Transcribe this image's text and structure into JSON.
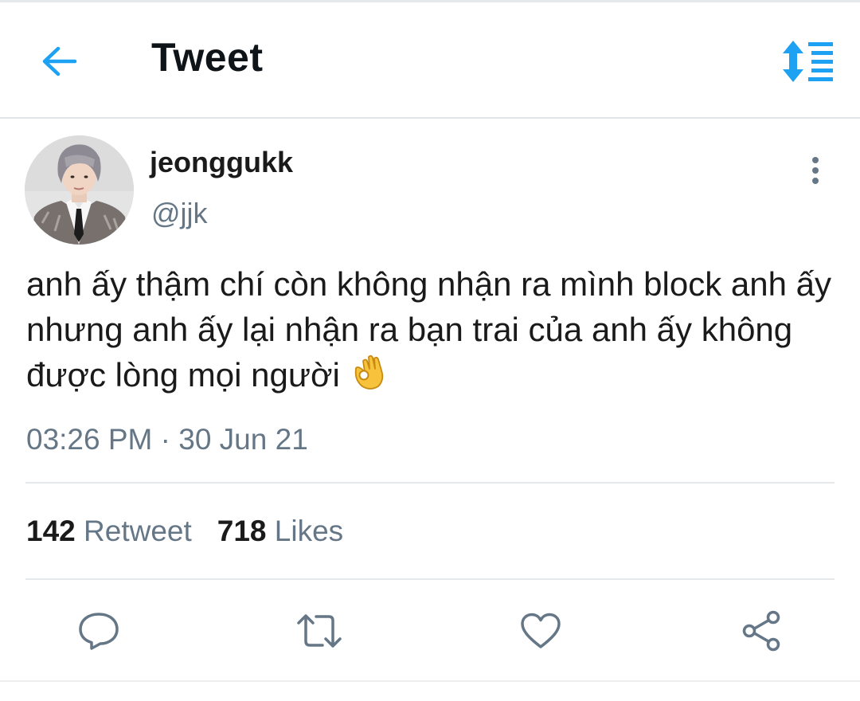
{
  "header": {
    "title": "Tweet",
    "back_icon": "arrow-left-icon",
    "sort_icon": "sort-list-icon",
    "accent_color": "#1da1f2"
  },
  "tweet": {
    "author": {
      "display_name": "jeonggukk",
      "handle": "@jjk"
    },
    "text": "anh ấy thậm chí còn không nhận ra mình block anh ấy nhưng anh ấy lại nhận ra bạn trai của anh ấy không được lòng mọi người",
    "emoji": "ok-hand-emoji",
    "timestamp": "03:26 PM · 30 Jun 21",
    "stats": {
      "retweets_count": "142",
      "retweets_label": "Retweet",
      "likes_count": "718",
      "likes_label": "Likes"
    }
  },
  "actions": [
    {
      "icon": "reply-icon"
    },
    {
      "icon": "retweet-icon"
    },
    {
      "icon": "like-icon"
    },
    {
      "icon": "share-icon"
    }
  ],
  "colors": {
    "text_primary": "#1a1a1a",
    "text_secondary": "#657786",
    "divider": "#e6e9ec",
    "icon_gray": "#657786"
  }
}
